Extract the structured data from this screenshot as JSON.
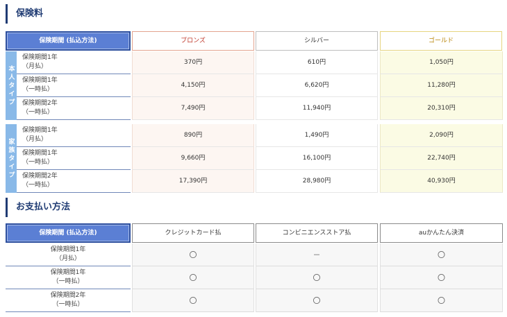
{
  "premium": {
    "title": "保険料",
    "header": {
      "period": "保険期間 (払込方法)",
      "bronze": "ブロンズ",
      "silver": "シルバー",
      "gold": "ゴールド"
    },
    "groups": [
      {
        "type_label": "本人タイプ",
        "rows": [
          {
            "line1": "保険期間1年",
            "line2": "（月払）",
            "bronze": "370円",
            "silver": "610円",
            "gold": "1,050円"
          },
          {
            "line1": "保険期間1年",
            "line2": "（一時払）",
            "bronze": "4,150円",
            "silver": "6,620円",
            "gold": "11,280円"
          },
          {
            "line1": "保険期間2年",
            "line2": "（一時払）",
            "bronze": "7,490円",
            "silver": "11,940円",
            "gold": "20,310円"
          }
        ]
      },
      {
        "type_label": "家族タイプ",
        "rows": [
          {
            "line1": "保険期間1年",
            "line2": "（月払）",
            "bronze": "890円",
            "silver": "1,490円",
            "gold": "2,090円"
          },
          {
            "line1": "保険期間1年",
            "line2": "（一時払）",
            "bronze": "9,660円",
            "silver": "16,100円",
            "gold": "22,740円"
          },
          {
            "line1": "保険期間2年",
            "line2": "（一時払）",
            "bronze": "17,390円",
            "silver": "28,980円",
            "gold": "40,930円"
          }
        ]
      }
    ]
  },
  "payment": {
    "title": "お支払い方法",
    "header": {
      "period": "保険期間 (払込方法)",
      "m1": "クレジットカード払",
      "m2": "コンビニエンスストア払",
      "m3": "auかんたん決済"
    },
    "rows": [
      {
        "line1": "保険期間1年",
        "line2": "（月払）",
        "m1": "〇",
        "m2": "－",
        "m3": "〇"
      },
      {
        "line1": "保険期間1年",
        "line2": "（一時払）",
        "m1": "〇",
        "m2": "〇",
        "m3": "〇"
      },
      {
        "line1": "保険期間2年",
        "line2": "（一時払）",
        "m1": "〇",
        "m2": "〇",
        "m3": "〇"
      }
    ]
  }
}
